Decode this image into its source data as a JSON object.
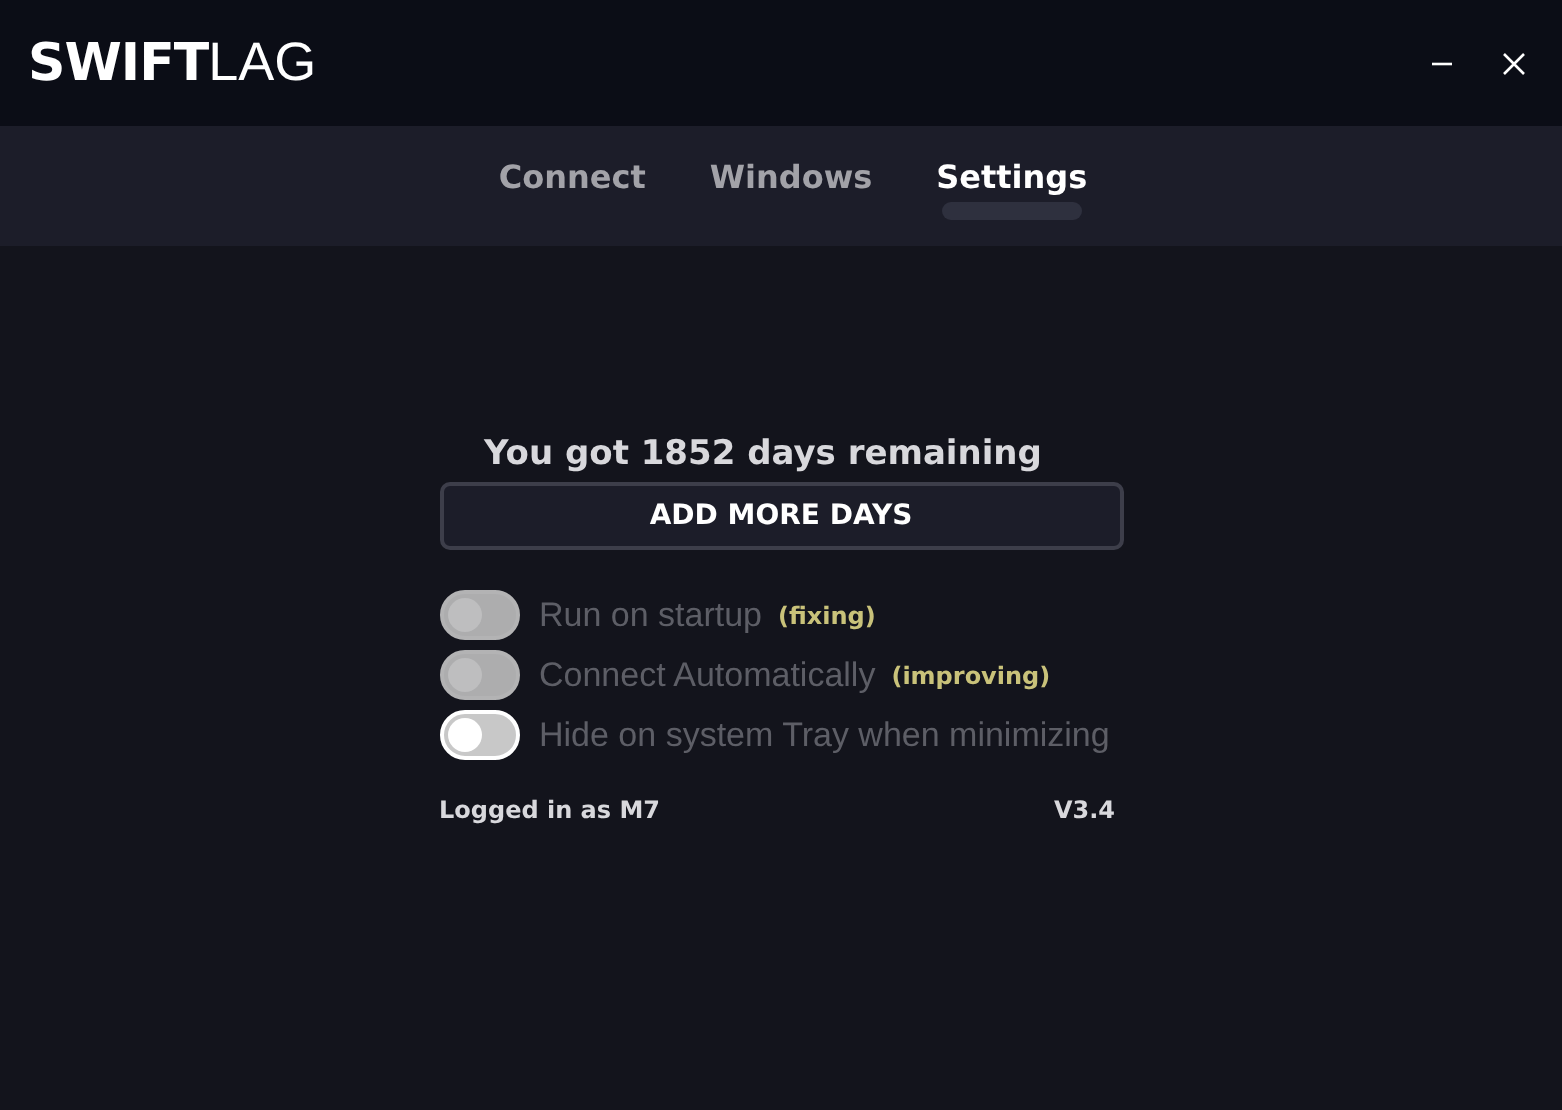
{
  "logo": {
    "bold": "SWIFT",
    "light": "LAG"
  },
  "window_controls": [
    {
      "kind": "minimize"
    },
    {
      "kind": "close"
    }
  ],
  "tabs": [
    {
      "label": "Connect",
      "selected": false
    },
    {
      "label": "Windows",
      "selected": false
    },
    {
      "label": "Settings",
      "selected": true
    }
  ],
  "remaining": "You got 1852 days remaining",
  "add_button": "ADD MORE DAYS",
  "toggles": [
    {
      "label": "Run on startup",
      "note": "(fixing)",
      "on": false,
      "disabled": true
    },
    {
      "label": "Connect Automatically",
      "note": "(improving)",
      "on": false,
      "disabled": true
    },
    {
      "label": "Hide on system Tray when minimizing",
      "on": false,
      "disabled": false
    }
  ],
  "footer": {
    "user": "Logged in as M7",
    "version": "V3.4"
  }
}
